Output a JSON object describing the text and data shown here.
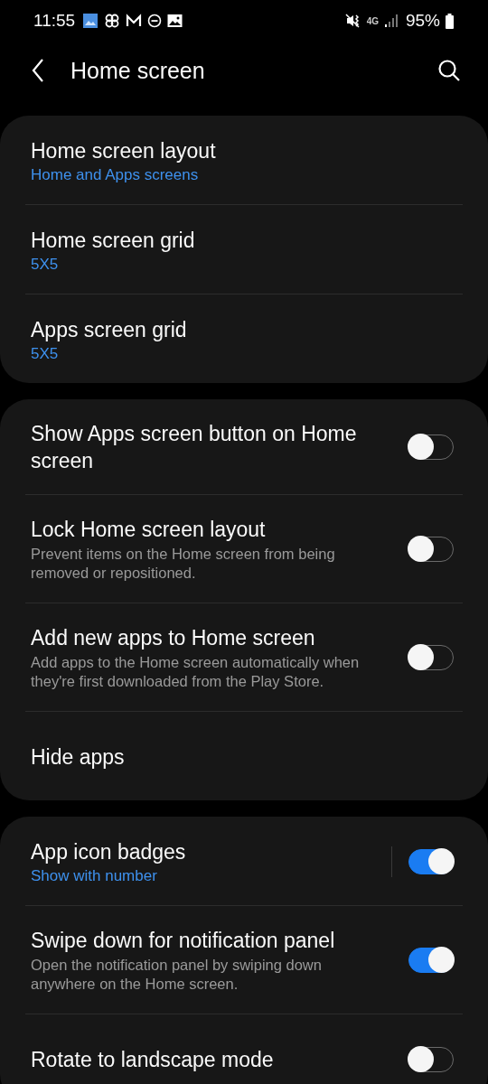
{
  "status_bar": {
    "time": "11:55",
    "network": "4G",
    "battery": "95%"
  },
  "header": {
    "title": "Home screen"
  },
  "groups": [
    {
      "items": [
        {
          "kind": "link",
          "title": "Home screen layout",
          "value": "Home and Apps screens"
        },
        {
          "kind": "link",
          "title": "Home screen grid",
          "value": "5X5"
        },
        {
          "kind": "link",
          "title": "Apps screen grid",
          "value": "5X5"
        }
      ]
    },
    {
      "items": [
        {
          "kind": "switch",
          "title": "Show Apps screen button on Home screen",
          "on": false,
          "divider": false
        },
        {
          "kind": "switch",
          "title": "Lock Home screen layout",
          "description": "Prevent items on the Home screen from being removed or repositioned.",
          "on": false,
          "divider": false
        },
        {
          "kind": "switch",
          "title": "Add new apps to Home screen",
          "description": "Add apps to the Home screen automatically when they're first downloaded from the Play Store.",
          "on": false,
          "divider": false
        },
        {
          "kind": "plain",
          "title": "Hide apps"
        }
      ]
    },
    {
      "items": [
        {
          "kind": "switch",
          "title": "App icon badges",
          "value": "Show with number",
          "on": true,
          "divider": true
        },
        {
          "kind": "switch",
          "title": "Swipe down for notification panel",
          "description": "Open the notification panel by swiping down anywhere on the Home screen.",
          "on": true,
          "divider": false
        },
        {
          "kind": "switch",
          "title": "Rotate to landscape mode",
          "on": false,
          "divider": false
        }
      ]
    }
  ]
}
